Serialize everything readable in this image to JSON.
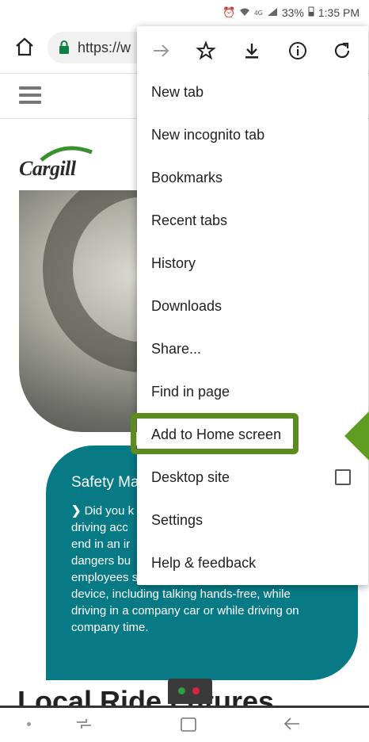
{
  "status_bar": {
    "icons": [
      "alarm-icon",
      "wifi-icon",
      "4g-lte-icon",
      "signal-icon",
      "battery-icon"
    ],
    "battery": "33%",
    "time": "1:35 PM"
  },
  "address_bar": {
    "url": "https://w",
    "lock_color": "#0b8043"
  },
  "page": {
    "logo": "Cargill",
    "card": {
      "title": "Safety Ma",
      "body_lines": [
        "Did you k",
        "driving acc",
        "end in an ir",
        "dangers bu",
        "employees safe, we no longer use a mobile",
        "device, including talking hands-free, while",
        "driving in a company car or while driving on",
        "company time."
      ],
      "color": "#087a86"
    },
    "bottom_heading": "Local Ride Futures"
  },
  "menu": {
    "toolbar_icons": [
      "forward-icon",
      "bookmark-star-icon",
      "download-icon",
      "info-icon",
      "reload-icon"
    ],
    "items": [
      {
        "label": "New tab"
      },
      {
        "label": "New incognito tab"
      },
      {
        "label": "Bookmarks"
      },
      {
        "label": "Recent tabs"
      },
      {
        "label": "History"
      },
      {
        "label": "Downloads"
      },
      {
        "label": "Share..."
      },
      {
        "label": "Find in page"
      },
      {
        "label": "Add to Home screen"
      },
      {
        "label": "Desktop site"
      },
      {
        "label": "Settings"
      },
      {
        "label": "Help & feedback"
      }
    ],
    "desktop_site_checked": false
  },
  "annotation": {
    "highlight_color": "#5f8a1f",
    "arrow_color": "#5f9d22"
  }
}
